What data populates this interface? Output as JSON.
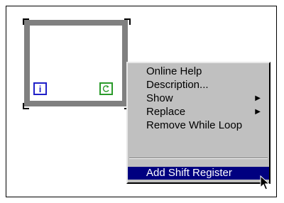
{
  "diagram": {
    "iteration_terminal": "i"
  },
  "context_menu": {
    "items": [
      {
        "label": "Online Help",
        "submenu": false
      },
      {
        "label": "Description...",
        "submenu": false
      },
      {
        "label": "Show",
        "submenu": true
      },
      {
        "label": "Replace",
        "submenu": true
      },
      {
        "label": "Remove While Loop",
        "submenu": false
      }
    ],
    "selected_item": {
      "label": "Add Shift Register"
    },
    "submenu_arrow": "▶"
  },
  "colors": {
    "menu_background": "#c0c0c0",
    "selection_background": "#000080",
    "loop_border": "#808080",
    "iteration_terminal": "#1f1fc8",
    "condition_terminal": "#2a9a2a"
  }
}
